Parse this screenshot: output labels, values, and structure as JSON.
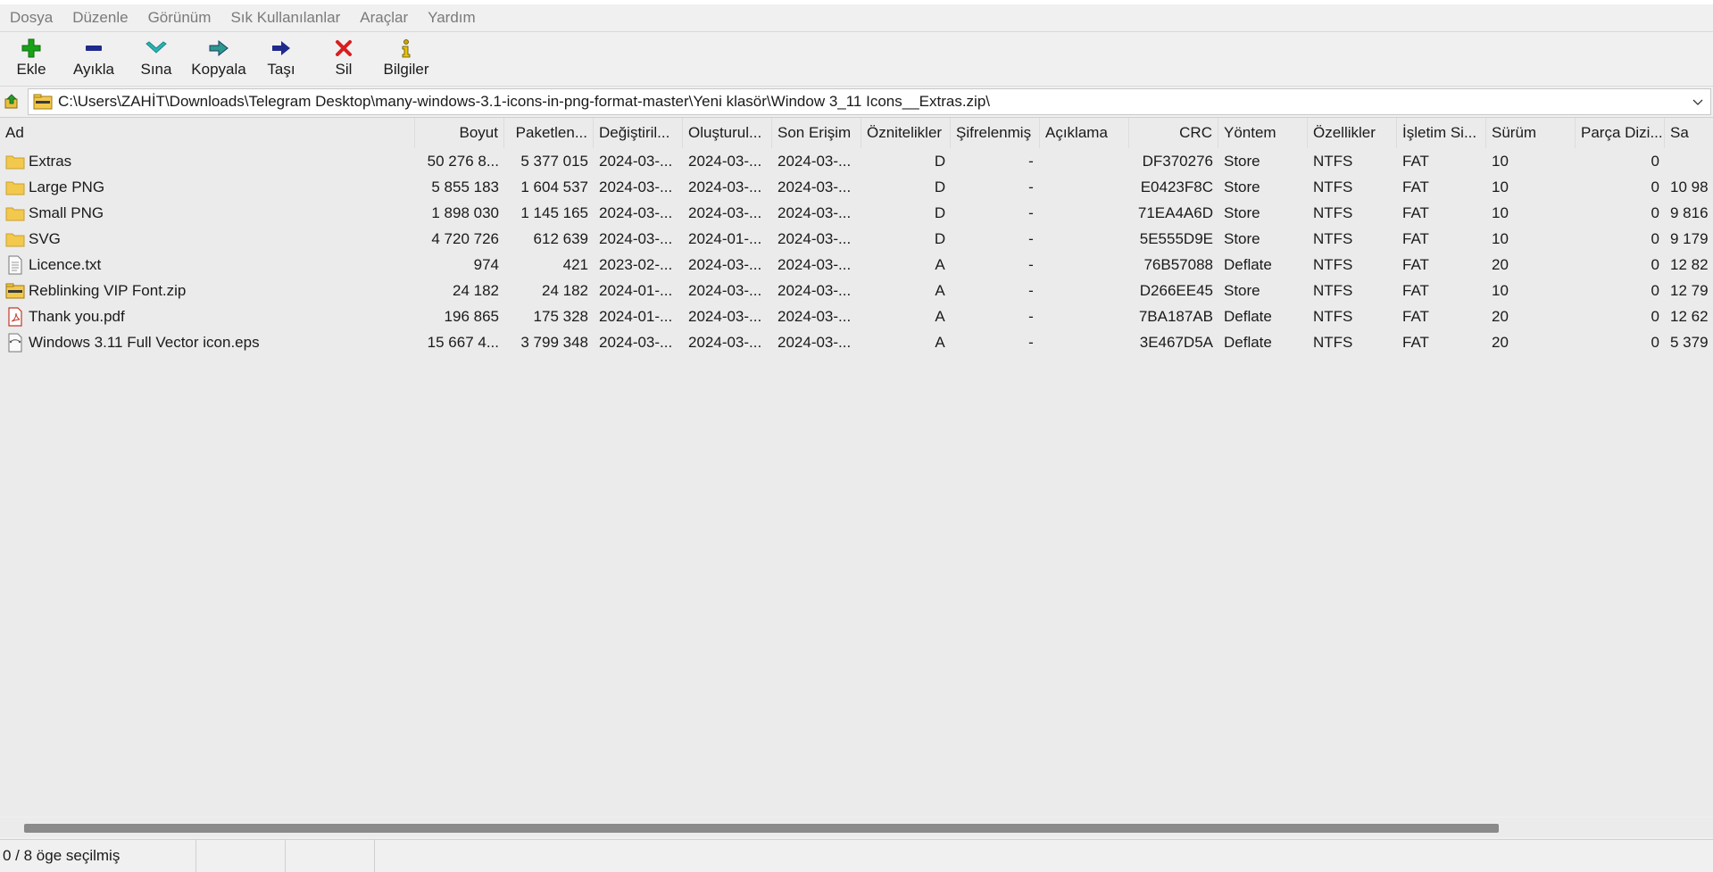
{
  "menu": [
    "Dosya",
    "Düzenle",
    "Görünüm",
    "Sık Kullanılanlar",
    "Araçlar",
    "Yardım"
  ],
  "toolbar": {
    "add": "Ekle",
    "extract": "Ayıkla",
    "test": "Sına",
    "copy": "Kopyala",
    "move": "Taşı",
    "delete": "Sil",
    "info": "Bilgiler"
  },
  "address": {
    "path": "C:\\Users\\ZAHİT\\Downloads\\Telegram Desktop\\many-windows-3.1-icons-in-png-format-master\\Yeni klasör\\Window 3_11 Icons__Extras.zip\\"
  },
  "columns": {
    "name": "Ad",
    "size": "Boyut",
    "packed": "Paketlen...",
    "modified": "Değiştiril...",
    "created": "Oluşturul...",
    "accessed": "Son Erişim",
    "attributes": "Öznitelikler",
    "encrypted": "Şifrelenmiş",
    "comment": "Açıklama",
    "crc": "CRC",
    "method": "Yöntem",
    "characteristics": "Özellikler",
    "hostos": "İşletim Si...",
    "version": "Sürüm",
    "volume": "Parça Dizi...",
    "offset": "Sa"
  },
  "rows": [
    {
      "icon": "folder-icon",
      "name": "Extras",
      "size": "50 276 8...",
      "packed": "5 377 015",
      "modified": "2024-03-...",
      "created": "2024-03-...",
      "accessed": "2024-03-...",
      "attributes": "D",
      "encrypted": "-",
      "comment": "",
      "crc": "DF370276",
      "method": "Store",
      "characteristics": "NTFS",
      "hostos": "FAT",
      "version": "10",
      "volume": "0",
      "offset": ""
    },
    {
      "icon": "folder-icon",
      "name": "Large PNG",
      "size": "5 855 183",
      "packed": "1 604 537",
      "modified": "2024-03-...",
      "created": "2024-03-...",
      "accessed": "2024-03-...",
      "attributes": "D",
      "encrypted": "-",
      "comment": "",
      "crc": "E0423F8C",
      "method": "Store",
      "characteristics": "NTFS",
      "hostos": "FAT",
      "version": "10",
      "volume": "0",
      "offset": "10 98"
    },
    {
      "icon": "folder-icon",
      "name": "Small PNG",
      "size": "1 898 030",
      "packed": "1 145 165",
      "modified": "2024-03-...",
      "created": "2024-03-...",
      "accessed": "2024-03-...",
      "attributes": "D",
      "encrypted": "-",
      "comment": "",
      "crc": "71EA4A6D",
      "method": "Store",
      "characteristics": "NTFS",
      "hostos": "FAT",
      "version": "10",
      "volume": "0",
      "offset": "9 816"
    },
    {
      "icon": "folder-icon",
      "name": "SVG",
      "size": "4 720 726",
      "packed": "612 639",
      "modified": "2024-03-...",
      "created": "2024-01-...",
      "accessed": "2024-03-...",
      "attributes": "D",
      "encrypted": "-",
      "comment": "",
      "crc": "5E555D9E",
      "method": "Store",
      "characteristics": "NTFS",
      "hostos": "FAT",
      "version": "10",
      "volume": "0",
      "offset": "9 179"
    },
    {
      "icon": "text-file-icon",
      "name": "Licence.txt",
      "size": "974",
      "packed": "421",
      "modified": "2023-02-...",
      "created": "2024-03-...",
      "accessed": "2024-03-...",
      "attributes": "A",
      "encrypted": "-",
      "comment": "",
      "crc": "76B57088",
      "method": "Deflate",
      "characteristics": "NTFS",
      "hostos": "FAT",
      "version": "20",
      "volume": "0",
      "offset": "12 82"
    },
    {
      "icon": "zip-file-icon",
      "name": "Reblinking VIP Font.zip",
      "size": "24 182",
      "packed": "24 182",
      "modified": "2024-01-...",
      "created": "2024-03-...",
      "accessed": "2024-03-...",
      "attributes": "A",
      "encrypted": "-",
      "comment": "",
      "crc": "D266EE45",
      "method": "Store",
      "characteristics": "NTFS",
      "hostos": "FAT",
      "version": "10",
      "volume": "0",
      "offset": "12 79"
    },
    {
      "icon": "pdf-file-icon",
      "name": "Thank you.pdf",
      "size": "196 865",
      "packed": "175 328",
      "modified": "2024-01-...",
      "created": "2024-03-...",
      "accessed": "2024-03-...",
      "attributes": "A",
      "encrypted": "-",
      "comment": "",
      "crc": "7BA187AB",
      "method": "Deflate",
      "characteristics": "NTFS",
      "hostos": "FAT",
      "version": "20",
      "volume": "0",
      "offset": "12 62"
    },
    {
      "icon": "eps-file-icon",
      "name": "Windows 3.11 Full Vector icon.eps",
      "size": "15 667 4...",
      "packed": "3 799 348",
      "modified": "2024-03-...",
      "created": "2024-03-...",
      "accessed": "2024-03-...",
      "attributes": "A",
      "encrypted": "-",
      "comment": "",
      "crc": "3E467D5A",
      "method": "Deflate",
      "characteristics": "NTFS",
      "hostos": "FAT",
      "version": "20",
      "volume": "0",
      "offset": "5 379"
    }
  ],
  "status": {
    "selection": "0 / 8 öge seçilmiş",
    "panel2": "",
    "panel3": ""
  },
  "colors": {
    "add_green": "#1aa11a",
    "extract_blue": "#1f2a8c",
    "test_teal": "#2bb3b3",
    "delete_red": "#d81e1e",
    "folder_yellow": "#f2c94c"
  }
}
